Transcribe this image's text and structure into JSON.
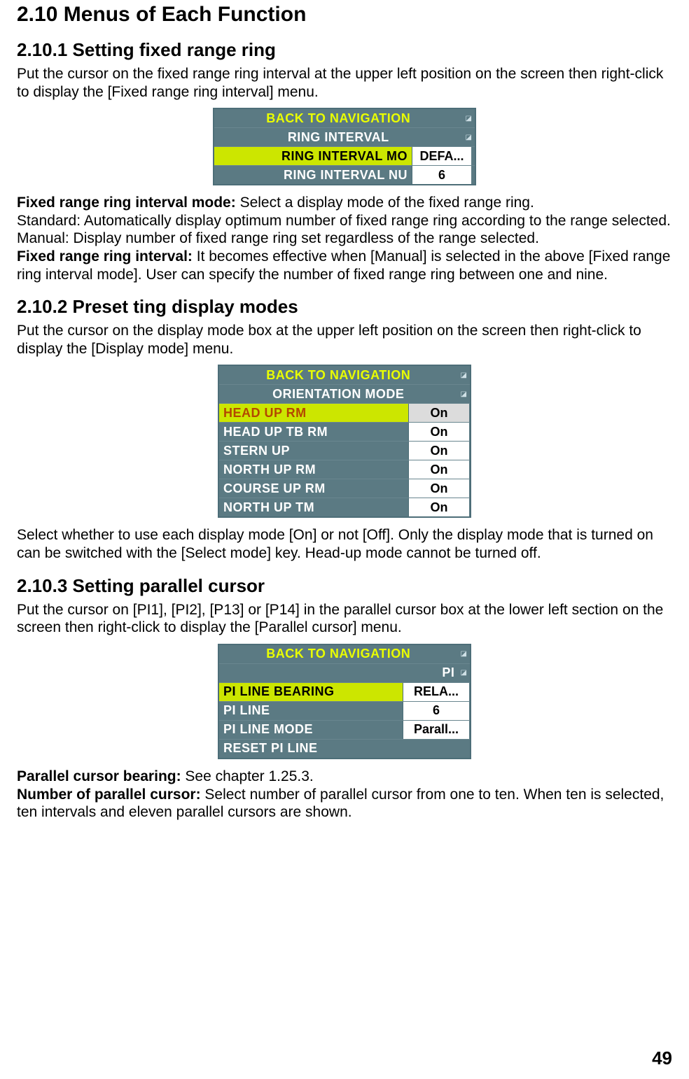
{
  "h1": "2.10 Menus of Each Function",
  "s1": {
    "heading": "2.10.1 Setting fixed range ring",
    "intro": "Put the cursor on the fixed range ring interval at the upper left position on the screen then right-click to display the [Fixed range ring interval] menu.",
    "menu": {
      "back": "BACK TO NAVIGATION",
      "header": "RING INTERVAL",
      "mode_label": "RING INTERVAL MO",
      "mode_value": "DEFA...",
      "num_label": "RING INTERVAL NU",
      "num_value": "6"
    },
    "after_lead": "Fixed range ring interval mode:",
    "after_lead_tail": " Select a display mode of the fixed range ring.",
    "line2": "Standard: Automatically display optimum number of fixed range ring according to the range selected.",
    "line3": "Manual: Display number of fixed range ring set regardless of the range selected.",
    "after_lead2": "Fixed range ring interval:",
    "after_lead2_tail": " It becomes effective when [Manual] is selected in the above [Fixed range ring interval mode]. User can specify the number of fixed range ring between one and nine."
  },
  "s2": {
    "heading": "2.10.2 Preset ting display modes",
    "intro": "Put the cursor on the display mode box at the upper left position on the screen then right-click to display the [Display mode] menu.",
    "menu": {
      "back": "BACK TO NAVIGATION",
      "header": "ORIENTATION MODE",
      "rows": [
        {
          "label": "HEAD UP RM",
          "value": "On",
          "highlight": true
        },
        {
          "label": "HEAD UP TB RM",
          "value": "On"
        },
        {
          "label": "STERN UP",
          "value": "On"
        },
        {
          "label": "NORTH UP RM",
          "value": "On"
        },
        {
          "label": "COURSE UP RM",
          "value": "On"
        },
        {
          "label": "NORTH UP TM",
          "value": "On"
        }
      ]
    },
    "after": "Select whether to use each display mode [On] or not [Off]. Only the display mode that is turned on can be switched with the [Select mode] key. Head-up mode cannot be turned off."
  },
  "s3": {
    "heading": "2.10.3 Setting parallel cursor",
    "intro": "Put the cursor on [PI1], [PI2], [P13] or [P14] in the parallel cursor box at the lower left section on the screen then right-click to display the [Parallel cursor] menu.",
    "menu": {
      "back": "BACK TO NAVIGATION",
      "header": "PI",
      "rows": [
        {
          "label": "PI LINE BEARING",
          "value": "RELA...",
          "highlight": true
        },
        {
          "label": "PI LINE",
          "value": "6"
        },
        {
          "label": "PI LINE MODE",
          "value": "Parall..."
        },
        {
          "label": "RESET PI LINE",
          "value": ""
        }
      ]
    },
    "after_lead1": "Parallel cursor bearing:",
    "after_lead1_tail": " See chapter 1.25.3.",
    "after_lead2": "Number of parallel cursor:",
    "after_lead2_tail": " Select number of parallel cursor from one to ten. When ten is selected, ten intervals and eleven parallel cursors are shown."
  },
  "page_number": "49"
}
